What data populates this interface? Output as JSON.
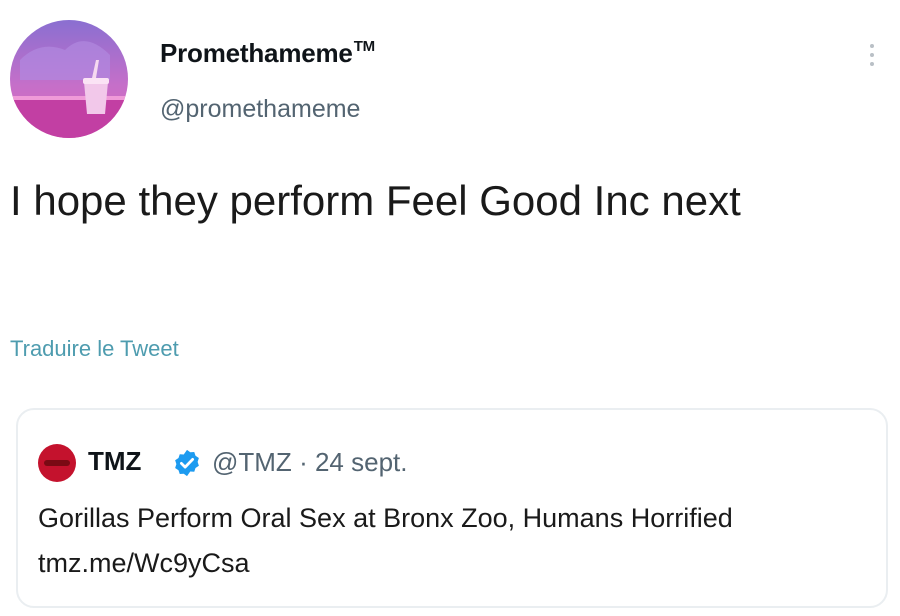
{
  "tweet": {
    "display_name": "Promethameme",
    "name_suffix": "TM",
    "handle": "@promethameme",
    "text": "I hope they perform Feel Good Inc next",
    "translate_label": "Traduire le Tweet",
    "avatar_icon": "profile-avatar-pink-cup",
    "more_icon": "more-options-vertical-dots"
  },
  "quoted_tweet": {
    "display_name": "TMZ",
    "verified_icon": "verified-badge-icon",
    "handle": "@TMZ",
    "date": "24 sept.",
    "separator": "·",
    "text": "Gorillas Perform Oral Sex at Bronx Zoo, Humans Horrified tmz.me/Wc9yCsa",
    "avatar_color": "#c4122d"
  },
  "colors": {
    "link": "#4e9caf",
    "secondary_text": "#536471",
    "verified": "#1d9bf0",
    "border": "#eaeef1"
  }
}
